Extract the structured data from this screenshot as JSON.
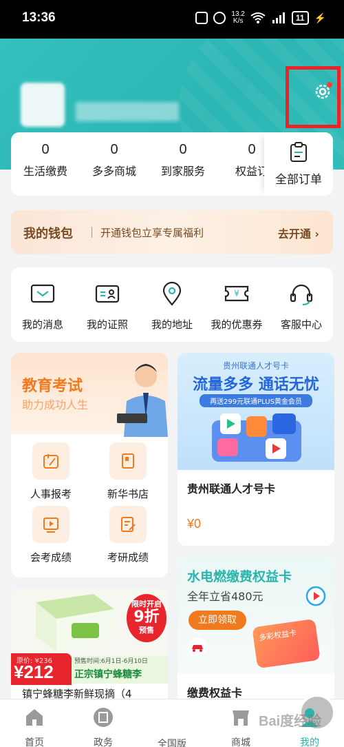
{
  "status_bar": {
    "time": "13:36",
    "net_speed": "13.2\nK/s",
    "battery": "11"
  },
  "orders": {
    "items": [
      {
        "count": "0",
        "label": "生活缴费"
      },
      {
        "count": "0",
        "label": "多多商城"
      },
      {
        "count": "0",
        "label": "到家服务"
      },
      {
        "count": "0",
        "label": "权益订"
      }
    ],
    "all_label": "全部订单"
  },
  "wallet": {
    "title": "我的钱包",
    "desc": "开通钱包立享专属福利",
    "action": "去开通 ›"
  },
  "services": [
    {
      "label": "我的消息",
      "icon": "message-icon"
    },
    {
      "label": "我的证照",
      "icon": "id-card-icon"
    },
    {
      "label": "我的地址",
      "icon": "location-icon"
    },
    {
      "label": "我的优惠券",
      "icon": "coupon-icon"
    },
    {
      "label": "客服中心",
      "icon": "headset-icon"
    }
  ],
  "edu": {
    "title": "教育考试",
    "subtitle": "助力成功人生",
    "items": [
      {
        "label": "人事报考",
        "icon": "exam-register-icon"
      },
      {
        "label": "新华书店",
        "icon": "bookstore-icon"
      },
      {
        "label": "会考成绩",
        "icon": "video-score-icon"
      },
      {
        "label": "考研成绩",
        "icon": "edit-score-icon"
      }
    ]
  },
  "sim": {
    "banner_top": "贵州联通人才号卡",
    "banner_main": "流量多多 通话无忧",
    "banner_sub": "再送299元联通PLUS黄金会员",
    "name": "贵州联通人才号卡",
    "price": "¥0"
  },
  "bee": {
    "orig_price": "原价: ¥236",
    "price": "¥212",
    "presale": "预售时间:6月1日-6月10日",
    "product": "正宗镇宁蜂糖李",
    "badge_top": "限时开启",
    "badge_big": "9折",
    "badge_bottom": "预售",
    "desc": "镇宁蜂糖李新鲜现摘（4"
  },
  "util": {
    "title": "水电燃缴费权益卡",
    "subtitle": "全年立省480元",
    "button": "立即领取",
    "card_text": "多彩权益卡",
    "name": "缴费权益卡"
  },
  "bottom_nav": [
    {
      "label": "首页",
      "icon": "home-icon"
    },
    {
      "label": "政务",
      "icon": "government-icon"
    },
    {
      "label": "全国版",
      "icon": "national-icon"
    },
    {
      "label": "商城",
      "icon": "shop-icon"
    },
    {
      "label": "我的",
      "icon": "profile-icon"
    }
  ],
  "watermark": "Bai度经验",
  "colors": {
    "header": "#35c1be",
    "accent": "#f07a1e",
    "highlight_box": "#ea2424"
  }
}
